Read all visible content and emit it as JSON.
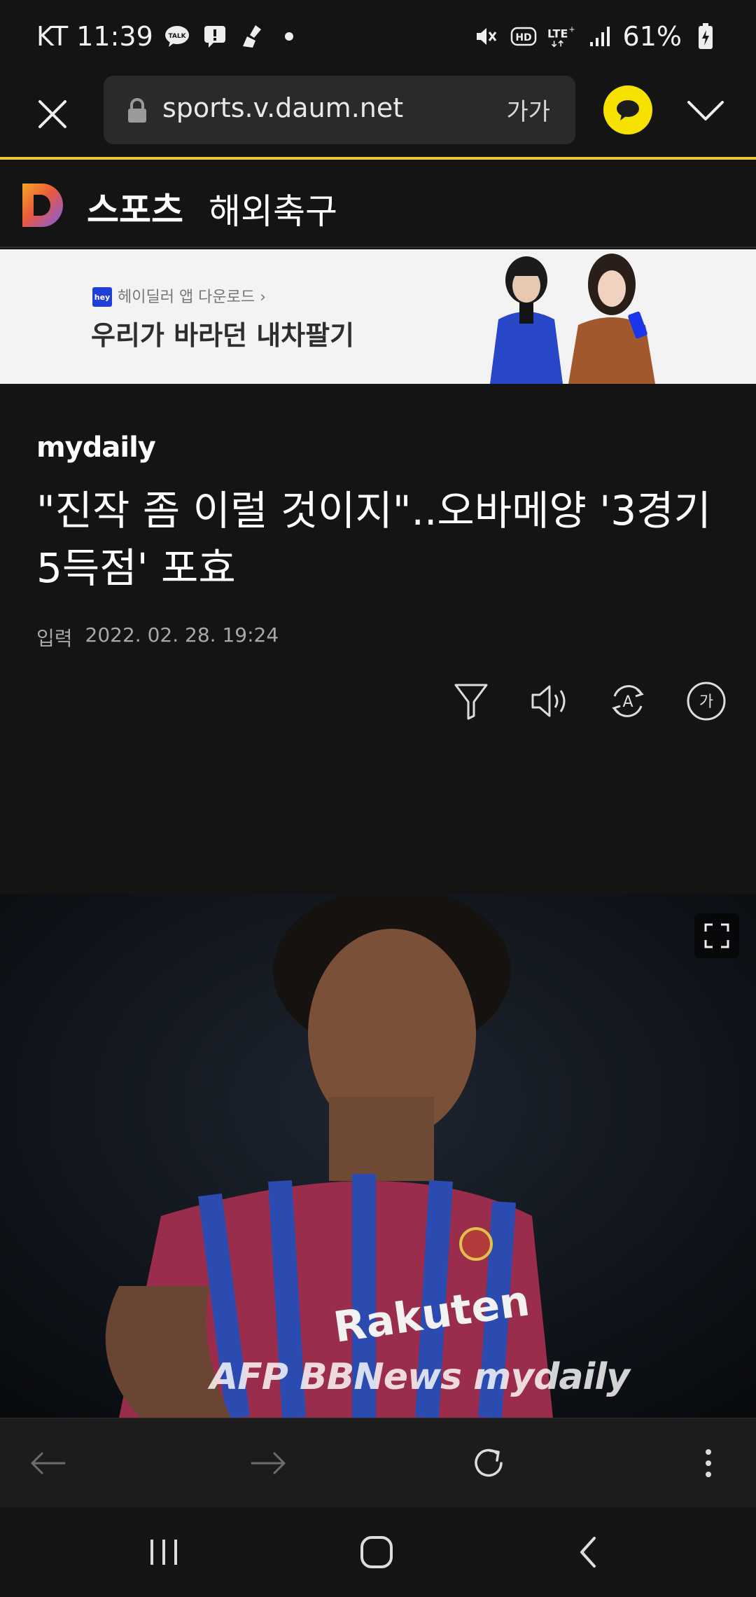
{
  "status_bar": {
    "carrier_time": "KT 11:39",
    "battery": "61%",
    "icons": [
      "kakaotalk-icon",
      "message-alert-icon",
      "cleaner-icon",
      "mute-icon",
      "hd-icon",
      "lte-icon",
      "signal-icon",
      "battery-charging-icon"
    ]
  },
  "url_bar": {
    "url": "sports.v.daum.net",
    "font_size_label": "가가"
  },
  "site_header": {
    "title": "스포츠",
    "section": "해외축구"
  },
  "ad": {
    "badge": "hey",
    "subtitle": "헤이딜러 앱 다운로드 ›",
    "title": "우리가 바라던 내차팔기"
  },
  "article": {
    "press": "mydaily",
    "headline": "\"진작 좀 이럴 것이지\"..오바메양 '3경기 5득점' 포효",
    "meta_label": "입력",
    "meta_date": "2022. 02. 28. 19:24",
    "tool_labels": {
      "font": "가",
      "translate": "A"
    },
    "photo_watermark": "AFP BBNews mydaily"
  },
  "colors": {
    "background": "#141414",
    "accent_yellow": "#e8c531",
    "kakao_yellow": "#f7e100"
  }
}
